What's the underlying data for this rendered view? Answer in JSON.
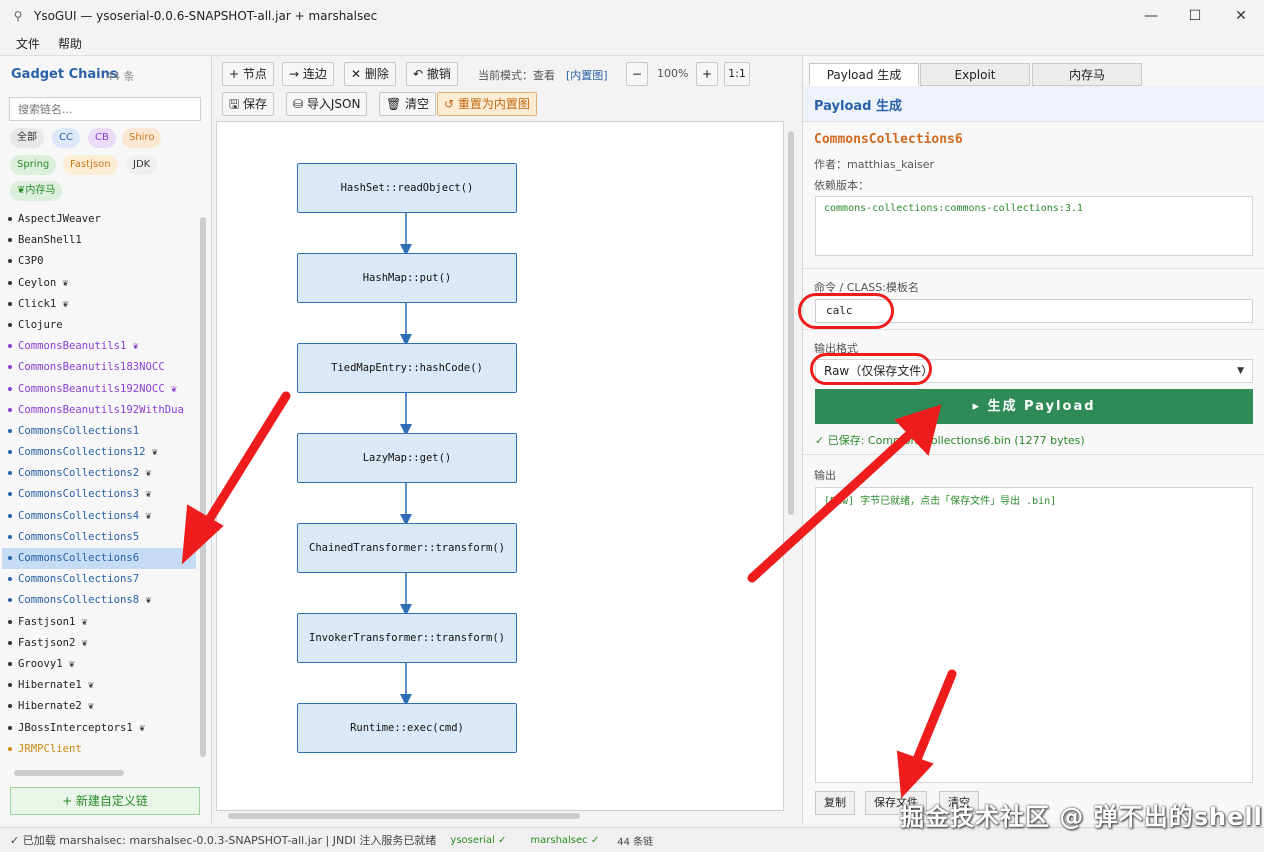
{
  "window": {
    "title": "YsoGUI  —  ysoserial-0.0.6-SNAPSHOT-all.jar  +  marshalsec",
    "minimize": "—",
    "maximize": "☐",
    "close": "✕"
  },
  "menu": {
    "file": "文件",
    "help": "帮助"
  },
  "left": {
    "title": "Gadget Chains",
    "count": "44 条",
    "search_placeholder": "搜索链名...",
    "chips": [
      "全部",
      "CC",
      "CB",
      "Shiro",
      "Spring",
      "Fastjson",
      "JDK",
      "❦内存马"
    ],
    "chains": [
      {
        "name": "AspectJWeaver",
        "mem": ""
      },
      {
        "name": "BeanShell1",
        "mem": ""
      },
      {
        "name": "C3P0",
        "mem": ""
      },
      {
        "name": "Ceylon",
        "mem": "❦"
      },
      {
        "name": "Click1",
        "mem": "❦"
      },
      {
        "name": "Clojure",
        "mem": ""
      },
      {
        "name": "CommonsBeanutils1",
        "mem": "❦"
      },
      {
        "name": "CommonsBeanutils183NOCC",
        "mem": ""
      },
      {
        "name": "CommonsBeanutils192NOCC",
        "mem": "❦"
      },
      {
        "name": "CommonsBeanutils192WithDua",
        "mem": ""
      },
      {
        "name": "CommonsCollections1",
        "mem": ""
      },
      {
        "name": "CommonsCollections12",
        "mem": "❦"
      },
      {
        "name": "CommonsCollections2",
        "mem": "❦"
      },
      {
        "name": "CommonsCollections3",
        "mem": "❦"
      },
      {
        "name": "CommonsCollections4",
        "mem": "❦"
      },
      {
        "name": "CommonsCollections5",
        "mem": ""
      },
      {
        "name": "CommonsCollections6",
        "mem": ""
      },
      {
        "name": "CommonsCollections7",
        "mem": ""
      },
      {
        "name": "CommonsCollections8",
        "mem": "❦"
      },
      {
        "name": "Fastjson1",
        "mem": "❦"
      },
      {
        "name": "Fastjson2",
        "mem": "❦"
      },
      {
        "name": "Groovy1",
        "mem": "❦"
      },
      {
        "name": "Hibernate1",
        "mem": "❦"
      },
      {
        "name": "Hibernate2",
        "mem": "❦"
      },
      {
        "name": "JBossInterceptors1",
        "mem": "❦"
      },
      {
        "name": "JRMPClient",
        "mem": ""
      }
    ],
    "new_chain": "+ 新建自定义链"
  },
  "toolbar": {
    "node": "+ 节点",
    "edge": "→ 连边",
    "delete": "✕ 删除",
    "undo": "↶ 撤销",
    "mode_label": "当前模式：查看",
    "mode_value": "[内置图]",
    "zoom_out": "−",
    "zoom": "100%",
    "zoom_in": "+",
    "reset_zoom": "1:1",
    "save": "🖫 保存",
    "import": "⛁ 导入JSON",
    "clear": "🗑 清空",
    "reset_builtin": "↺ 重置为内置图"
  },
  "graph_nodes": [
    "HashSet::readObject()",
    "HashMap::put()",
    "TiedMapEntry::hashCode()",
    "LazyMap::get()",
    "ChainedTransformer::transform()",
    "InvokerTransformer::transform()",
    "Runtime::exec(cmd)"
  ],
  "right": {
    "tabs": [
      "Payload 生成",
      "Exploit",
      "内存马"
    ],
    "header": "Payload 生成",
    "chain_name": "CommonsCollections6",
    "author": "作者：matthias_kaiser",
    "dep_label": "依赖版本：",
    "dep_value": "commons-collections:commons-collections:3.1",
    "cmd_label": "命令 / CLASS:模板名",
    "cmd_value": "calc",
    "format_label": "输出格式",
    "format_value": "Raw（仅保存文件）",
    "generate": "▸ 生成 Payload",
    "saved": "✓ 已保存: CommonsCollections6.bin  (1277 bytes)",
    "output_label": "输出",
    "output_text": "[Raw] 字节已就绪，点击「保存文件」导出 .bin]",
    "copy": "复制",
    "save_file": "保存文件",
    "clear": "清空"
  },
  "status": {
    "loaded": "✓ 已加载 marshalsec: marshalsec-0.0.3-SNAPSHOT-all.jar  |  JNDI 注入服务已就绪",
    "ysoserial": "ysoserial ✓",
    "marshalsec": "marshalsec ✓",
    "count": "44 条链"
  },
  "watermark": "掘金技术社区 @ 弹不出的shell"
}
